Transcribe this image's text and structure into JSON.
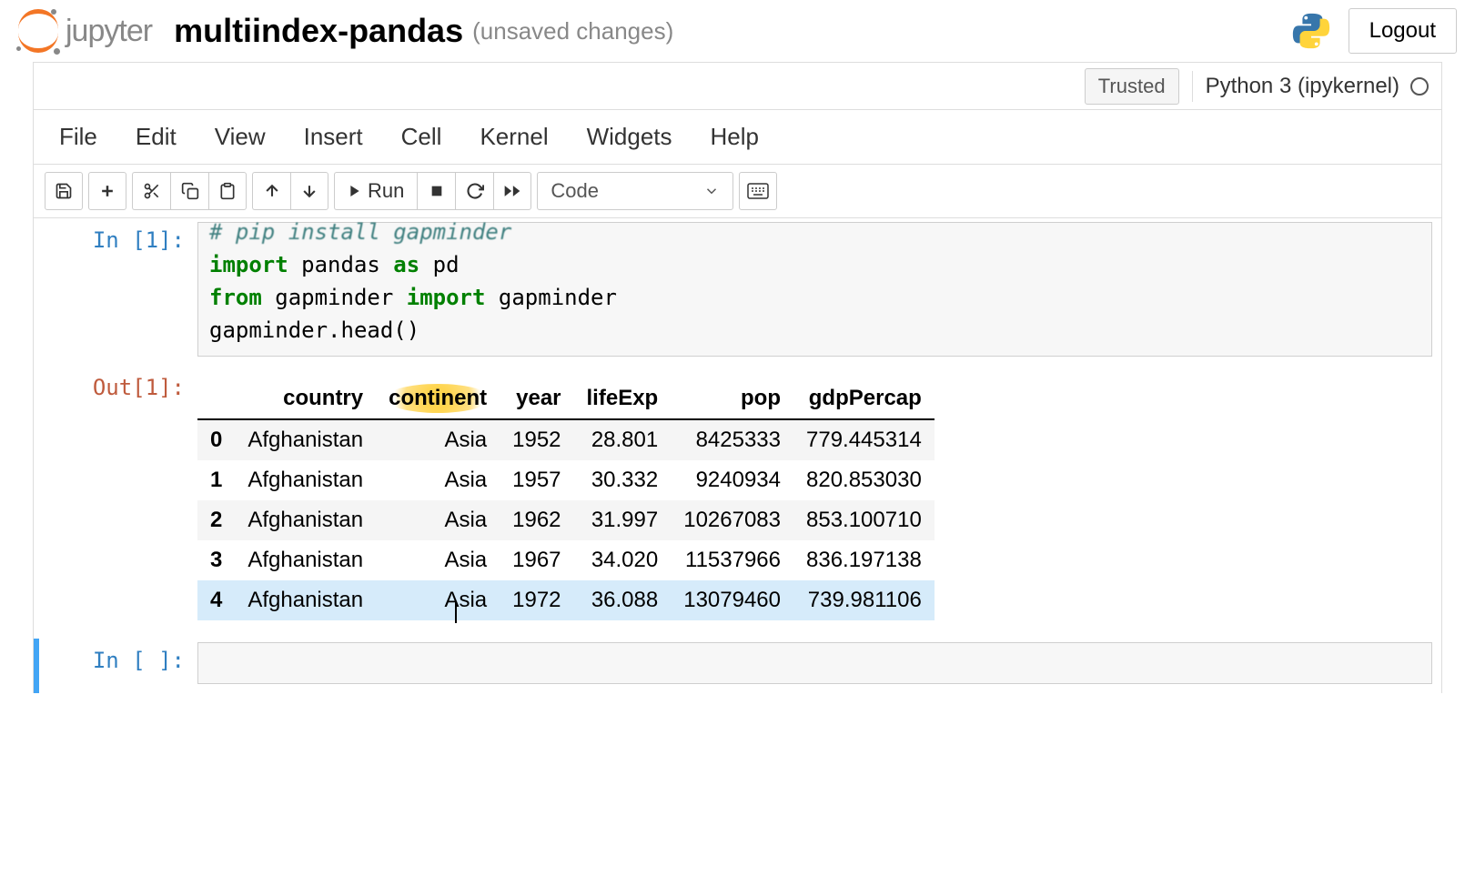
{
  "header": {
    "jupyter_text": "jupyter",
    "notebook_title": "multiindex-pandas",
    "unsaved": "(unsaved changes)",
    "logout": "Logout"
  },
  "kernel_bar": {
    "trusted": "Trusted",
    "kernel_name": "Python 3 (ipykernel)"
  },
  "menu": {
    "file": "File",
    "edit": "Edit",
    "view": "View",
    "insert": "Insert",
    "cell": "Cell",
    "kernel": "Kernel",
    "widgets": "Widgets",
    "help": "Help"
  },
  "toolbar": {
    "run": "Run",
    "cell_type": "Code"
  },
  "cells": {
    "in1_prompt": "In [1]:",
    "in1_comment": "# pip install gapminder",
    "in1_line_blank": "",
    "in1_line2_a": "import",
    "in1_line2_b": " pandas ",
    "in1_line2_c": "as",
    "in1_line2_d": " pd",
    "in1_line3_a": "from",
    "in1_line3_b": " gapminder ",
    "in1_line3_c": "import",
    "in1_line3_d": " gapminder",
    "in1_line4": "gapminder.head()",
    "out1_prompt": "Out[1]:",
    "in_empty_prompt": "In [ ]:"
  },
  "dataframe": {
    "columns": [
      "country",
      "continent",
      "year",
      "lifeExp",
      "pop",
      "gdpPercap"
    ],
    "index": [
      "0",
      "1",
      "2",
      "3",
      "4"
    ],
    "rows": [
      [
        "Afghanistan",
        "Asia",
        "1952",
        "28.801",
        "8425333",
        "779.445314"
      ],
      [
        "Afghanistan",
        "Asia",
        "1957",
        "30.332",
        "9240934",
        "820.853030"
      ],
      [
        "Afghanistan",
        "Asia",
        "1962",
        "31.997",
        "10267083",
        "853.100710"
      ],
      [
        "Afghanistan",
        "Asia",
        "1967",
        "34.020",
        "11537966",
        "836.197138"
      ],
      [
        "Afghanistan",
        "Asia",
        "1972",
        "36.088",
        "13079460",
        "739.981106"
      ]
    ]
  }
}
